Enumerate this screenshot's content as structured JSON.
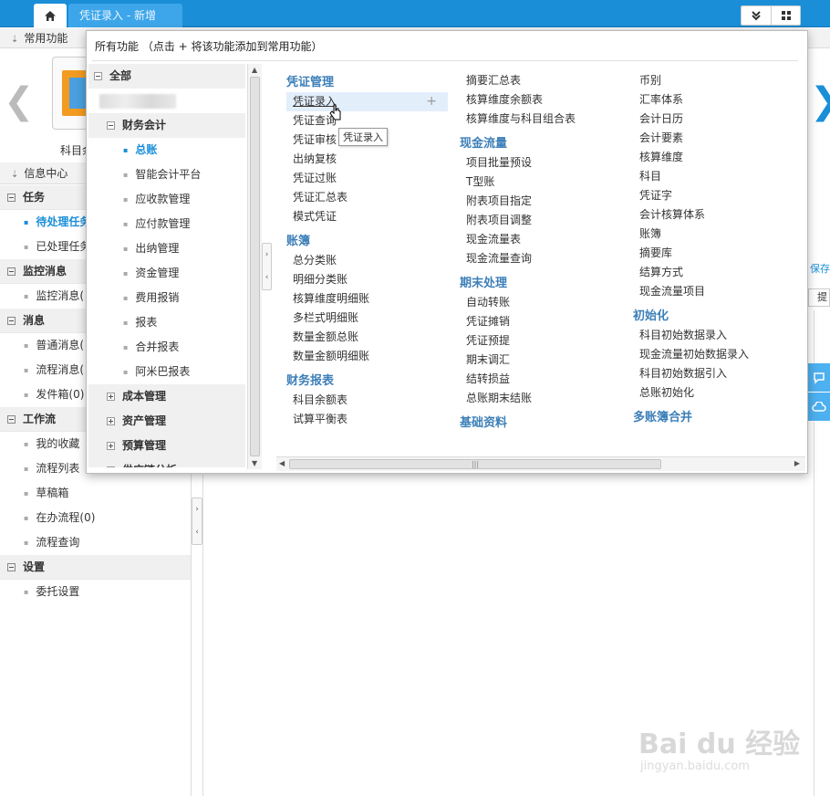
{
  "topbar": {
    "home_icon": "home-icon",
    "active_tab": "凭证录入 - 新增",
    "buttons": [
      "chevron-double-down-icon",
      "grid-icon"
    ]
  },
  "common_bar": {
    "label": "常用功能"
  },
  "carousel": {
    "left_arrow": "❮",
    "right_arrow": "❯",
    "app_label": "科目余"
  },
  "info_center": {
    "label": "信息中心",
    "sections": [
      {
        "title": "任务",
        "items": [
          {
            "label": "待处理任务",
            "active": true
          },
          {
            "label": "已处理任务"
          }
        ]
      },
      {
        "title": "监控消息",
        "items": [
          {
            "label": "监控消息("
          }
        ]
      },
      {
        "title": "消息",
        "items": [
          {
            "label": "普通消息("
          },
          {
            "label": "流程消息("
          },
          {
            "label": "发件箱(0)"
          }
        ]
      },
      {
        "title": "工作流",
        "items": [
          {
            "label": "我的收藏"
          },
          {
            "label": "流程列表"
          },
          {
            "label": "草稿箱"
          },
          {
            "label": "在办流程(0)"
          },
          {
            "label": "流程查询"
          }
        ]
      },
      {
        "title": "设置",
        "items": [
          {
            "label": "委托设置"
          }
        ]
      }
    ]
  },
  "right_edge": {
    "save": "保存",
    "box": "提"
  },
  "popup": {
    "title": "所有功能  （点击 + 将该功能添加到常用功能）",
    "tree": {
      "root": "全部",
      "group": "财务会计",
      "items": [
        "总账",
        "智能会计平台",
        "应收款管理",
        "应付款管理",
        "出纳管理",
        "资金管理",
        "费用报销",
        "报表",
        "合并报表",
        "阿米巴报表"
      ],
      "collapsed": [
        "成本管理",
        "资产管理",
        "预算管理",
        "供应链分析"
      ]
    },
    "columns": [
      {
        "groups": [
          {
            "title": "凭证管理",
            "items": [
              "凭证录入",
              "凭证查询",
              "凭证审核",
              "出纳复核",
              "凭证过账",
              "凭证汇总表",
              "模式凭证"
            ]
          },
          {
            "title": "账簿",
            "items": [
              "总分类账",
              "明细分类账",
              "核算维度明细账",
              "多栏式明细账",
              "数量金额总账",
              "数量金额明细账"
            ]
          },
          {
            "title": "财务报表",
            "items": [
              "科目余额表",
              "试算平衡表"
            ]
          }
        ]
      },
      {
        "groups": [
          {
            "title": "",
            "items": [
              "摘要汇总表",
              "核算维度余额表",
              "核算维度与科目组合表"
            ]
          },
          {
            "title": "现金流量",
            "items": [
              "项目批量预设",
              "T型账",
              "附表项目指定",
              "附表项目调整",
              "现金流量表",
              "现金流量查询"
            ]
          },
          {
            "title": "期末处理",
            "items": [
              "自动转账",
              "凭证摊销",
              "凭证预提",
              "期末调汇",
              "结转损益",
              "总账期末结账"
            ]
          },
          {
            "title": "基础资料",
            "items": []
          }
        ]
      },
      {
        "groups": [
          {
            "title": "",
            "items": [
              "币别",
              "汇率体系",
              "会计日历",
              "会计要素",
              "核算维度",
              "科目",
              "凭证字",
              "会计核算体系",
              "账簿",
              "摘要库",
              "结算方式",
              "现金流量项目"
            ]
          },
          {
            "title": "初始化",
            "items": [
              "科目初始数据录入",
              "现金流量初始数据录入",
              "科目初始数据引入",
              "总账初始化"
            ]
          },
          {
            "title": "多账簿合并",
            "items": []
          }
        ]
      }
    ],
    "tooltip": "凭证录入"
  },
  "watermark": {
    "main": "Bai du 经验",
    "sub": "jingyan.baidu.com"
  }
}
